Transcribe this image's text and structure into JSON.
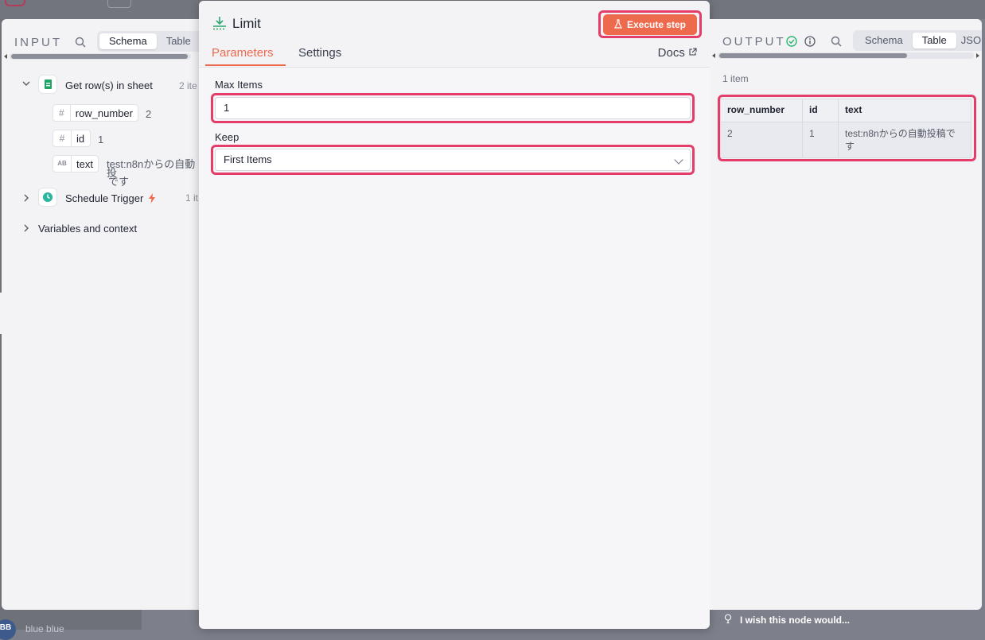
{
  "background": {
    "user": "blue blue"
  },
  "input": {
    "title": "INPUT",
    "views": [
      "Schema",
      "Table"
    ],
    "active_view": "Schema",
    "nodes": [
      {
        "name": "Get row(s) in sheet",
        "meta": "2 ite",
        "expanded": true,
        "icon": "google-sheets-icon"
      },
      {
        "name": "Schedule Trigger",
        "meta": "1 it",
        "expanded": false,
        "icon": "clock-icon"
      }
    ],
    "fields": [
      {
        "type": "#",
        "name": "row_number",
        "value": "2"
      },
      {
        "type": "#",
        "name": "id",
        "value": "1"
      },
      {
        "type": "AB",
        "name": "text",
        "value_line1": "test:n8nからの自動投",
        "value_line2": "です"
      }
    ],
    "variables": "Variables and context"
  },
  "node": {
    "title": "Limit",
    "execute_label": "Execute step",
    "tabs": [
      "Parameters",
      "Settings"
    ],
    "active_tab": "Parameters",
    "docs_label": "Docs",
    "max_items_label": "Max Items",
    "max_items_value": "1",
    "keep_label": "Keep",
    "keep_value": "First Items"
  },
  "output": {
    "title": "OUTPUT",
    "views": [
      "Schema",
      "Table",
      "JSO"
    ],
    "active_view": "Table",
    "count": "1 item",
    "columns": [
      "row_number",
      "id",
      "text"
    ],
    "rows": [
      {
        "row_number": "2",
        "id": "1",
        "text_line1": "test:n8nからの自動投稿で",
        "text_line2": "す"
      }
    ]
  },
  "feedback": {
    "label": "I wish this node would..."
  },
  "colors": {
    "accent": "#ee6a4d",
    "highlight": "#e43d6a",
    "success": "#2fb36e",
    "sheets": "#1fa463"
  }
}
